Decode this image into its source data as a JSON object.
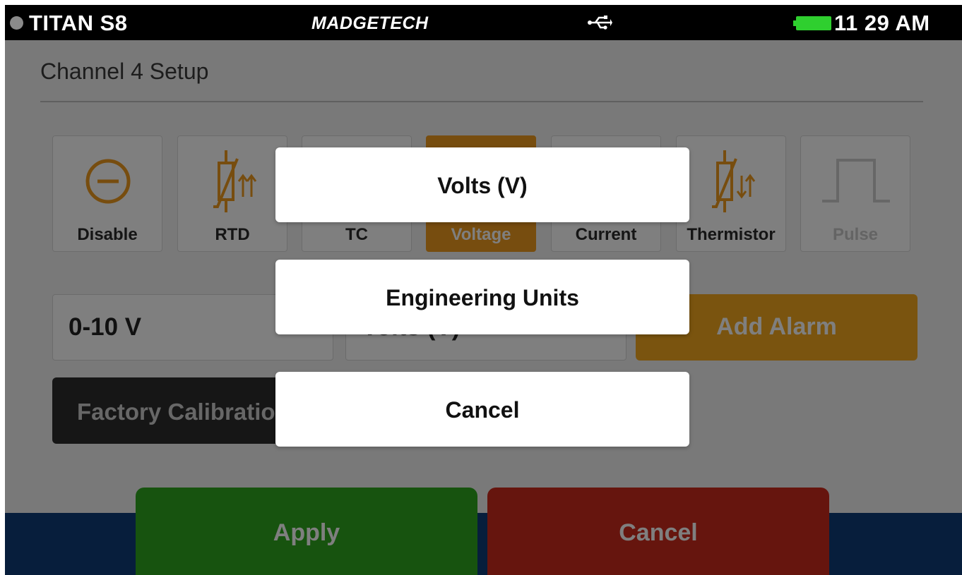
{
  "status_bar": {
    "device": "TITAN S8",
    "brand": "MADGETECH",
    "time": "11 29 AM",
    "battery_color": "#2fcf2f",
    "icons": [
      "status-dot",
      "usb-icon",
      "battery-icon"
    ]
  },
  "page": {
    "title": "Channel 4 Setup"
  },
  "input_types": [
    {
      "label": "Disable",
      "icon": "disable-icon",
      "state": "normal"
    },
    {
      "label": "RTD",
      "icon": "rtd-icon",
      "state": "normal"
    },
    {
      "label": "TC",
      "icon": "thermocouple-icon",
      "state": "normal"
    },
    {
      "label": "Voltage",
      "icon": "voltage-icon",
      "state": "selected"
    },
    {
      "label": "Current",
      "icon": "current-icon",
      "state": "normal"
    },
    {
      "label": "Thermistor",
      "icon": "thermistor-icon",
      "state": "normal"
    },
    {
      "label": "Pulse",
      "icon": "pulse-icon",
      "state": "disabled"
    }
  ],
  "settings": {
    "range_value": "0-10 V",
    "units_value": "Volts (V)",
    "add_alarm_label": "Add Alarm",
    "factory_calibration_label": "Factory Calibration"
  },
  "footer": {
    "apply_label": "Apply",
    "cancel_label": "Cancel"
  },
  "units_dialog": {
    "options": [
      "Volts (V)",
      "Engineering Units",
      "Cancel"
    ]
  },
  "colors": {
    "accent_orange": "#ef9a1e",
    "apply_green": "#2ea61f",
    "cancel_red": "#cc2b1d",
    "footer_blue": "#0f3c78"
  }
}
